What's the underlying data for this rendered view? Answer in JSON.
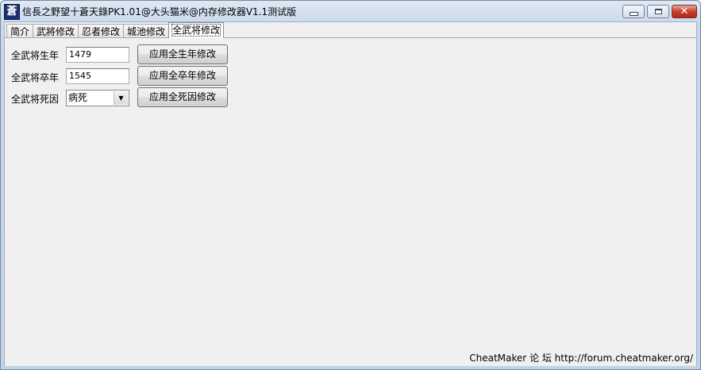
{
  "window": {
    "title": "信長之野望十蒼天錄PK1.01@大头猫米@内存修改器V1.1测试版",
    "app_icon_glyph": "蒼",
    "app_icon_name": "app-icon",
    "controls": {
      "minimize_icon": "minimize-icon",
      "maximize_icon": "maximize-icon",
      "close_icon": "close-icon",
      "close_glyph": "✕"
    }
  },
  "tabs": [
    {
      "label": "简介",
      "active": false
    },
    {
      "label": "武將修改",
      "active": false
    },
    {
      "label": "忍者修改",
      "active": false
    },
    {
      "label": "城池修改",
      "active": false
    },
    {
      "label": "全武将修改",
      "active": true
    }
  ],
  "form": {
    "birth_year": {
      "label": "全武将生年",
      "value": "1479",
      "button": "应用全生年修改"
    },
    "death_year": {
      "label": "全武将卒年",
      "value": "1545",
      "button": "应用全卒年修改"
    },
    "death_cause": {
      "label": "全武将死因",
      "selected": "病死",
      "arrow_glyph": "▼",
      "button": "应用全死因修改"
    }
  },
  "status": {
    "text": "CheatMaker 论 坛 http://forum.cheatmaker.org/"
  },
  "colors": {
    "title_gradient_top": "#dfe9f5",
    "client_bg": "#f0f0f0",
    "close_button": "#c8412f"
  }
}
